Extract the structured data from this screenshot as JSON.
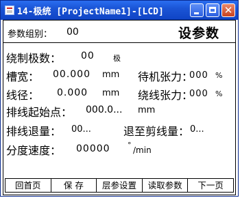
{
  "window": {
    "title": "14-极统 [ProjectName1]-[LCD]",
    "icon": "app-icon",
    "controls": {
      "minimize_icon": "minimize-icon",
      "maximize_icon": "maximize-icon",
      "close_icon": "close-icon",
      "close_glyph": "✕"
    }
  },
  "header": {
    "group_label": "参数组别：",
    "group_value": "00",
    "title": "设参数"
  },
  "fields": {
    "winding_poles": {
      "label": "绕制极数：",
      "value": "00",
      "unit": "极"
    },
    "slot_width": {
      "label": "槽宽：",
      "value": "00.000",
      "unit": "mm"
    },
    "standby_tension": {
      "label": "待机张力：",
      "value": "000",
      "unit": "%"
    },
    "wire_diameter": {
      "label": "线径：",
      "value": "0.000",
      "unit": "mm"
    },
    "winding_tension": {
      "label": "绕线张力：",
      "value": "000",
      "unit": "%"
    },
    "wire_start_point": {
      "label": "排线起始点：",
      "value": "000.0...",
      "unit": "mm"
    },
    "wire_retreat": {
      "label": "排线退量：",
      "value": "00..."
    },
    "cut_retreat": {
      "label": "退至剪线量：",
      "value": "0..."
    },
    "indexing_speed": {
      "label": "分度速度：",
      "value": "00000",
      "unit_sup": "°",
      "unit": "/min"
    }
  },
  "nav": {
    "home": "回首页",
    "save": "保 存",
    "layer_settings": "层参设置",
    "read_params": "读取参数",
    "next_page": "下一页"
  },
  "colors": {
    "titlebar": "#1b55d6",
    "close_button": "#c9421f",
    "frame": "#0a2a8f"
  }
}
